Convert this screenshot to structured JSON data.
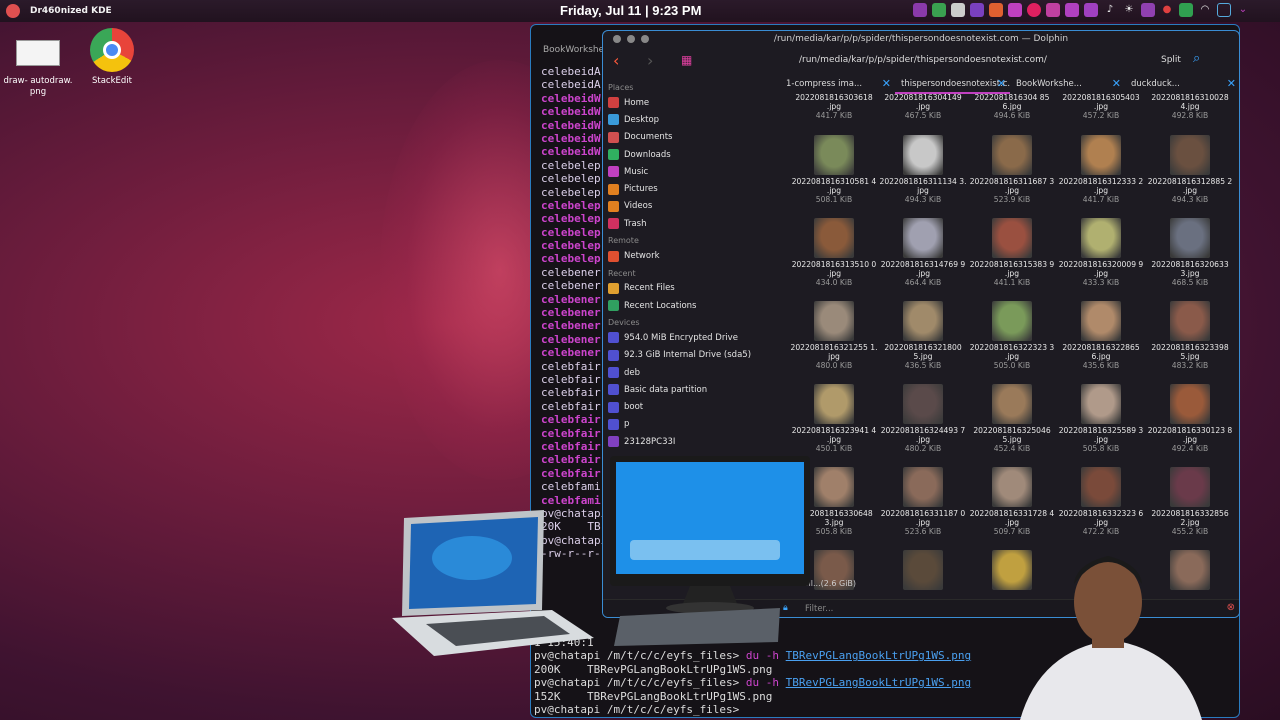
{
  "panel": {
    "title": "Dr460nized KDE",
    "clock": "Friday, Jul 11 | 9:23 PM"
  },
  "desktop": {
    "icons": [
      {
        "label": "draw- autodraw.\npng",
        "icon": "image-file-icon"
      },
      {
        "label": "StackEdit",
        "icon": "chrome-app-icon"
      }
    ]
  },
  "terminal": {
    "tab_label": "BookWorkshee",
    "lines": [
      {
        "t": "celebeidA",
        "s": "p"
      },
      {
        "t": "celebeidA",
        "s": "p"
      },
      {
        "t": "celebeidW",
        "s": "b"
      },
      {
        "t": "celebeidW",
        "s": "b"
      },
      {
        "t": "celebeidW",
        "s": "b"
      },
      {
        "t": "celebeidW",
        "s": "b"
      },
      {
        "t": "celebeidW",
        "s": "b"
      },
      {
        "t": "celebelep",
        "s": "p"
      },
      {
        "t": "celebelep",
        "s": "p"
      },
      {
        "t": "celebelep",
        "s": "p"
      },
      {
        "t": "celebelep",
        "s": "b"
      },
      {
        "t": "celebelep",
        "s": "b"
      },
      {
        "t": "celebelep",
        "s": "b"
      },
      {
        "t": "celebelep",
        "s": "b"
      },
      {
        "t": "celebelep",
        "s": "b"
      },
      {
        "t": "celebener",
        "s": "p"
      },
      {
        "t": "celebener",
        "s": "p"
      },
      {
        "t": "celebener",
        "s": "b"
      },
      {
        "t": "celebener",
        "s": "b"
      },
      {
        "t": "celebener",
        "s": "b"
      },
      {
        "t": "celebener",
        "s": "b"
      },
      {
        "t": "celebener",
        "s": "b"
      },
      {
        "t": "celebfair",
        "s": "p"
      },
      {
        "t": "celebfair",
        "s": "p"
      },
      {
        "t": "celebfair",
        "s": "p"
      },
      {
        "t": "celebfair",
        "s": "p"
      },
      {
        "t": "celebfair",
        "s": "b"
      },
      {
        "t": "celebfair",
        "s": "b"
      },
      {
        "t": "celebfair",
        "s": "b"
      },
      {
        "t": "celebfair",
        "s": "b"
      },
      {
        "t": "celebfair",
        "s": "b"
      },
      {
        "t": "celebfami",
        "s": "p"
      },
      {
        "t": "celebfami",
        "s": "b"
      },
      {
        "t": "pv@chatapi",
        "s": "p"
      },
      {
        "t": "20K    TB",
        "s": "p"
      },
      {
        "t": "pv@chatapi",
        "s": "p"
      },
      {
        "t": "-rw-r--r-",
        "s": "p"
      }
    ],
    "bottom": [
      {
        "prompt": "",
        "cmd": "",
        "rest": "1 15:40:1"
      },
      {
        "prompt": "pv@chatapi /m/t/c/c/eyfs_files>",
        "cmd": " du -h ",
        "rest": "TBRevPGLangBookLtrUPg1WS.png"
      },
      {
        "prompt": "200K",
        "cmd": "",
        "rest": "    TBRevPGLangBookLtrUPg1WS.png"
      },
      {
        "prompt": "pv@chatapi /m/t/c/c/eyfs_files>",
        "cmd": " du -h ",
        "rest": "TBRevPGLangBookLtrUPg1WS.png"
      },
      {
        "prompt": "152K",
        "cmd": "",
        "rest": "    TBRevPGLangBookLtrUPg1WS.png"
      },
      {
        "prompt": "pv@chatapi /m/t/c/c/eyfs_files>",
        "cmd": "",
        "rest": ""
      }
    ]
  },
  "dolphin": {
    "title": "/run/media/kar/p/p/spider/thispersondoesnotexist.com — Dolphin",
    "path": "/run/media/kar/p/p/spider/thispersondoesnotexist.com/",
    "split_label": "Split",
    "tabs": [
      {
        "label": "1-compress ima...",
        "active": false
      },
      {
        "label": "thispersondoesnotexist.c...",
        "active": true
      },
      {
        "label": "BookWorkshe...",
        "active": false
      },
      {
        "label": "duckduck...",
        "active": false
      }
    ],
    "places": {
      "sections": [
        {
          "title": "Places",
          "items": [
            {
              "label": "Home",
              "color": "#d04040"
            },
            {
              "label": "Desktop",
              "color": "#3a9ad9"
            },
            {
              "label": "Documents",
              "color": "#d05050"
            },
            {
              "label": "Downloads",
              "color": "#30b060"
            },
            {
              "label": "Music",
              "color": "#c040c0"
            },
            {
              "label": "Pictures",
              "color": "#e08020"
            },
            {
              "label": "Videos",
              "color": "#e08020"
            },
            {
              "label": "Trash",
              "color": "#d03060"
            }
          ]
        },
        {
          "title": "Remote",
          "items": [
            {
              "label": "Network",
              "color": "#e05030"
            }
          ]
        },
        {
          "title": "Recent",
          "items": [
            {
              "label": "Recent Files",
              "color": "#e0a030"
            },
            {
              "label": "Recent Locations",
              "color": "#30a060"
            }
          ]
        },
        {
          "title": "Devices",
          "items": [
            {
              "label": "954.0 MiB Encrypted Drive",
              "color": "#5050d0"
            },
            {
              "label": "92.3 GiB Internal Drive (sda5)",
              "color": "#5050d0"
            },
            {
              "label": "deb",
              "color": "#5050d0"
            },
            {
              "label": "Basic data partition",
              "color": "#5050d0"
            },
            {
              "label": "boot",
              "color": "#5050d0"
            },
            {
              "label": "p",
              "color": "#5050d0"
            },
            {
              "label": "23128PC33I",
              "color": "#8040c0"
            }
          ]
        }
      ]
    },
    "files": [
      {
        "name": "2022081816303618\n.jpg",
        "size": "441.7 KiB",
        "tone": "none"
      },
      {
        "name": "2022081816304149\n.jpg",
        "size": "467.5 KiB",
        "tone": "none"
      },
      {
        "name": "2022081816304 85\n6.jpg",
        "size": "494.6 KiB",
        "tone": "none"
      },
      {
        "name": "2022081816305403\n.jpg",
        "size": "457.2 KiB",
        "tone": "none"
      },
      {
        "name": "2022081816310028\n4.jpg",
        "size": "492.8 KiB",
        "tone": "none"
      },
      {
        "name": "2022081816310581 4\n.jpg",
        "size": "508.1 KiB",
        "tone": "#7a8a5a"
      },
      {
        "name": "2022081816311134 3.\njpg",
        "size": "494.3 KiB",
        "tone": "#c8c8c8"
      },
      {
        "name": "2022081816311687 3\n.jpg",
        "size": "523.9 KiB",
        "tone": "#8a6a4a"
      },
      {
        "name": "2022081816312333 2\n.jpg",
        "size": "441.7 KiB",
        "tone": "#b08050"
      },
      {
        "name": "2022081816312885 2\n.jpg",
        "size": "494.3 KiB",
        "tone": "#6a5040"
      },
      {
        "name": "2022081816313510 0\n.jpg",
        "size": "434.0 KiB",
        "tone": "#8a5a3a"
      },
      {
        "name": "2022081816314769 9\n.jpg",
        "size": "464.4 KiB",
        "tone": "#a0a0b0"
      },
      {
        "name": "2022081816315383 9\n.jpg",
        "size": "441.1 KiB",
        "tone": "#9a5040"
      },
      {
        "name": "2022081816320009 9\n.jpg",
        "size": "433.3 KiB",
        "tone": "#b0b070"
      },
      {
        "name": "2022081816320633\n3.jpg",
        "size": "468.5 KiB",
        "tone": "#6a7080"
      },
      {
        "name": "2022081816321255 1.\njpg",
        "size": "480.0 KiB",
        "tone": "#9a8a7a"
      },
      {
        "name": "2022081816321800\n5.jpg",
        "size": "436.5 KiB",
        "tone": "#a08a6a"
      },
      {
        "name": "2022081816322323 3\n.jpg",
        "size": "505.0 KiB",
        "tone": "#7a9a5a"
      },
      {
        "name": "2022081816322865\n6.jpg",
        "size": "435.6 KiB",
        "tone": "#b08a6a"
      },
      {
        "name": "2022081816323398\n5.jpg",
        "size": "483.2 KiB",
        "tone": "#8a5a4a"
      },
      {
        "name": "2022081816323941 4\n.jpg",
        "size": "450.1 KiB",
        "tone": "#b09a6a"
      },
      {
        "name": "2022081816324493 7\n.jpg",
        "size": "480.2 KiB",
        "tone": "#5a4a4a"
      },
      {
        "name": "2022081816325046\n5.jpg",
        "size": "452.4 KiB",
        "tone": "#9a7a5a"
      },
      {
        "name": "2022081816325589 3\n.jpg",
        "size": "505.8 KiB",
        "tone": "#b09a8a"
      },
      {
        "name": "2022081816330123 8\n.jpg",
        "size": "492.4 KiB",
        "tone": "#9a5a3a"
      },
      {
        "name": "2022081816330648\n3.jpg",
        "size": "505.8 KiB",
        "tone": "#a0806a"
      },
      {
        "name": "2022081816331187 0\n.jpg",
        "size": "523.6 KiB",
        "tone": "#8a6a5a"
      },
      {
        "name": "2022081816331728 4\n.jpg",
        "size": "509.7 KiB",
        "tone": "#a08a7a"
      },
      {
        "name": "2022081816332323 6\n.jpg",
        "size": "472.2 KiB",
        "tone": "#7a4a3a"
      },
      {
        "name": "2022081816332856\n2.jpg",
        "size": "455.2 KiB",
        "tone": "#6a3a4a"
      },
      {
        "name": "",
        "size": "",
        "tone": "#7a5a4a"
      },
      {
        "name": "",
        "size": "",
        "tone": "#5a4a3a"
      },
      {
        "name": "",
        "size": "",
        "tone": "#c0a040"
      },
      {
        "name": "",
        "size": "",
        "tone": "none"
      },
      {
        "name": "",
        "size": "",
        "tone": "#8a6a5a"
      }
    ],
    "status": "37 fil...(2.6 GiB)",
    "filter_placeholder": "Filter..."
  }
}
